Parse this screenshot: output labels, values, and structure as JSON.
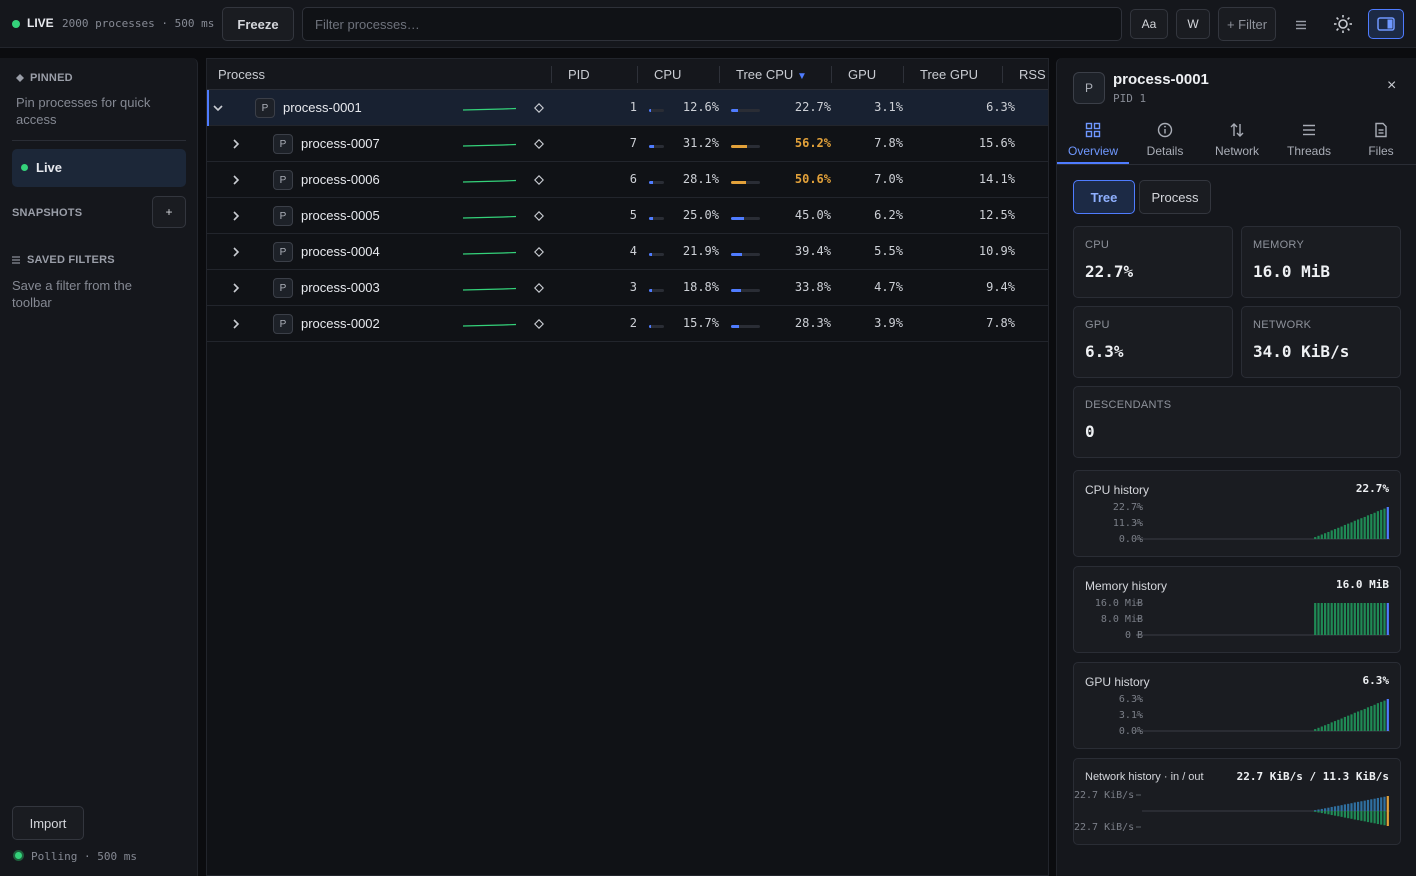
{
  "topbar": {
    "live_label": "LIVE",
    "stats": "2000 processes · 500 ms",
    "freeze_label": "Freeze",
    "filter_placeholder": "Filter processes…",
    "case_label": "Aa",
    "word_label": "W",
    "add_filter_label": "+ Filter"
  },
  "sidebar": {
    "pinned_title": "PINNED",
    "pinned_hint": "Pin processes for quick access",
    "live_label": "Live",
    "snapshots_title": "SNAPSHOTS",
    "add_snapshot_label": "+",
    "saved_filters_title": "SAVED FILTERS",
    "saved_filters_hint": "Save a filter from the toolbar",
    "import_label": "Import",
    "polling_status": "Polling · 500 ms"
  },
  "table": {
    "columns": [
      "Process",
      "PID",
      "CPU",
      "Tree CPU",
      "GPU",
      "Tree GPU",
      "RSS"
    ],
    "sort_indicator": "▼",
    "rows": [
      {
        "name": "process-0001",
        "pid": "1",
        "cpu": "12.6%",
        "cpu_frac": 0.126,
        "tree_cpu": "22.7%",
        "tree_cpu_frac": 0.227,
        "gpu": "3.1%",
        "tree_gpu": "6.3%",
        "expanded": true,
        "level": 0,
        "badge": "P",
        "hot": false
      },
      {
        "name": "process-0007",
        "pid": "7",
        "cpu": "31.2%",
        "cpu_frac": 0.312,
        "tree_cpu": "56.2%",
        "tree_cpu_frac": 0.562,
        "gpu": "7.8%",
        "tree_gpu": "15.6%",
        "expanded": false,
        "level": 1,
        "badge": "P",
        "hot": true
      },
      {
        "name": "process-0006",
        "pid": "6",
        "cpu": "28.1%",
        "cpu_frac": 0.281,
        "tree_cpu": "50.6%",
        "tree_cpu_frac": 0.506,
        "gpu": "7.0%",
        "tree_gpu": "14.1%",
        "expanded": false,
        "level": 1,
        "badge": "P",
        "hot": true
      },
      {
        "name": "process-0005",
        "pid": "5",
        "cpu": "25.0%",
        "cpu_frac": 0.25,
        "tree_cpu": "45.0%",
        "tree_cpu_frac": 0.45,
        "gpu": "6.2%",
        "tree_gpu": "12.5%",
        "expanded": false,
        "level": 1,
        "badge": "P",
        "hot": false
      },
      {
        "name": "process-0004",
        "pid": "4",
        "cpu": "21.9%",
        "cpu_frac": 0.219,
        "tree_cpu": "39.4%",
        "tree_cpu_frac": 0.394,
        "gpu": "5.5%",
        "tree_gpu": "10.9%",
        "expanded": false,
        "level": 1,
        "badge": "P",
        "hot": false
      },
      {
        "name": "process-0003",
        "pid": "3",
        "cpu": "18.8%",
        "cpu_frac": 0.188,
        "tree_cpu": "33.8%",
        "tree_cpu_frac": 0.338,
        "gpu": "4.7%",
        "tree_gpu": "9.4%",
        "expanded": false,
        "level": 1,
        "badge": "P",
        "hot": false
      },
      {
        "name": "process-0002",
        "pid": "2",
        "cpu": "15.7%",
        "cpu_frac": 0.157,
        "tree_cpu": "28.3%",
        "tree_cpu_frac": 0.283,
        "gpu": "3.9%",
        "tree_gpu": "7.8%",
        "expanded": false,
        "level": 1,
        "badge": "P",
        "hot": false
      }
    ]
  },
  "detail": {
    "badge": "P",
    "title": "process-0001",
    "pid_label": "PID 1",
    "close_label": "×",
    "tabs": [
      {
        "label": "Overview",
        "icon": "grid-icon",
        "active": true
      },
      {
        "label": "Details",
        "icon": "info-icon",
        "active": false
      },
      {
        "label": "Network",
        "icon": "arrows-updown-icon",
        "active": false
      },
      {
        "label": "Threads",
        "icon": "list-icon",
        "active": false
      },
      {
        "label": "Files",
        "icon": "file-icon",
        "active": false
      }
    ],
    "mode_tree_label": "Tree",
    "mode_process_label": "Process",
    "cards": {
      "cpu": {
        "label": "CPU",
        "value": "22.7%"
      },
      "memory": {
        "label": "MEMORY",
        "value": "16.0 MiB"
      },
      "gpu": {
        "label": "GPU",
        "value": "6.3%"
      },
      "network": {
        "label": "NETWORK",
        "value": "34.0 KiB/s"
      },
      "descendants": {
        "label": "DESCENDANTS",
        "value": "0"
      }
    },
    "history": {
      "cpu": {
        "title": "CPU history",
        "value": "22.7%",
        "ticks": [
          "22.7%",
          "11.3%",
          "0.0%"
        ],
        "samples": [
          0.06,
          0.1,
          0.14,
          0.18,
          0.22,
          0.27,
          0.31,
          0.35,
          0.39,
          0.44,
          0.48,
          0.52,
          0.57,
          0.61,
          0.65,
          0.69,
          0.74,
          0.78,
          0.82,
          0.87,
          0.91,
          0.95,
          1.0
        ]
      },
      "memory": {
        "title": "Memory history",
        "value": "16.0 MiB",
        "ticks": [
          "16.0 MiB",
          "8.0 MiB",
          "0 B"
        ],
        "samples": [
          1,
          1,
          1,
          1,
          1,
          1,
          1,
          1,
          1,
          1,
          1,
          1,
          1,
          1,
          1,
          1,
          1,
          1,
          1,
          1,
          1,
          1,
          1
        ]
      },
      "gpu": {
        "title": "GPU history",
        "value": "6.3%",
        "ticks": [
          "6.3%",
          "3.1%",
          "0.0%"
        ],
        "samples": [
          0.06,
          0.1,
          0.14,
          0.18,
          0.22,
          0.27,
          0.31,
          0.35,
          0.39,
          0.44,
          0.48,
          0.52,
          0.57,
          0.61,
          0.65,
          0.69,
          0.74,
          0.78,
          0.82,
          0.87,
          0.91,
          0.95,
          1.0
        ]
      },
      "network": {
        "title": "Network history · in / out",
        "value": "22.7 KiB/s / 11.3 KiB/s",
        "ticks": [
          "22.7 KiB/s",
          "22.7 KiB/s"
        ],
        "samples": [
          0.06,
          0.1,
          0.14,
          0.18,
          0.22,
          0.27,
          0.31,
          0.35,
          0.39,
          0.44,
          0.48,
          0.52,
          0.57,
          0.61,
          0.65,
          0.69,
          0.74,
          0.78,
          0.82,
          0.87,
          0.91,
          0.95,
          1.0
        ]
      }
    }
  },
  "colors": {
    "accent": "#4f7cff",
    "live_green": "#34d27a",
    "bar_green": "#1f8a55",
    "hot": "#e2a13a"
  }
}
